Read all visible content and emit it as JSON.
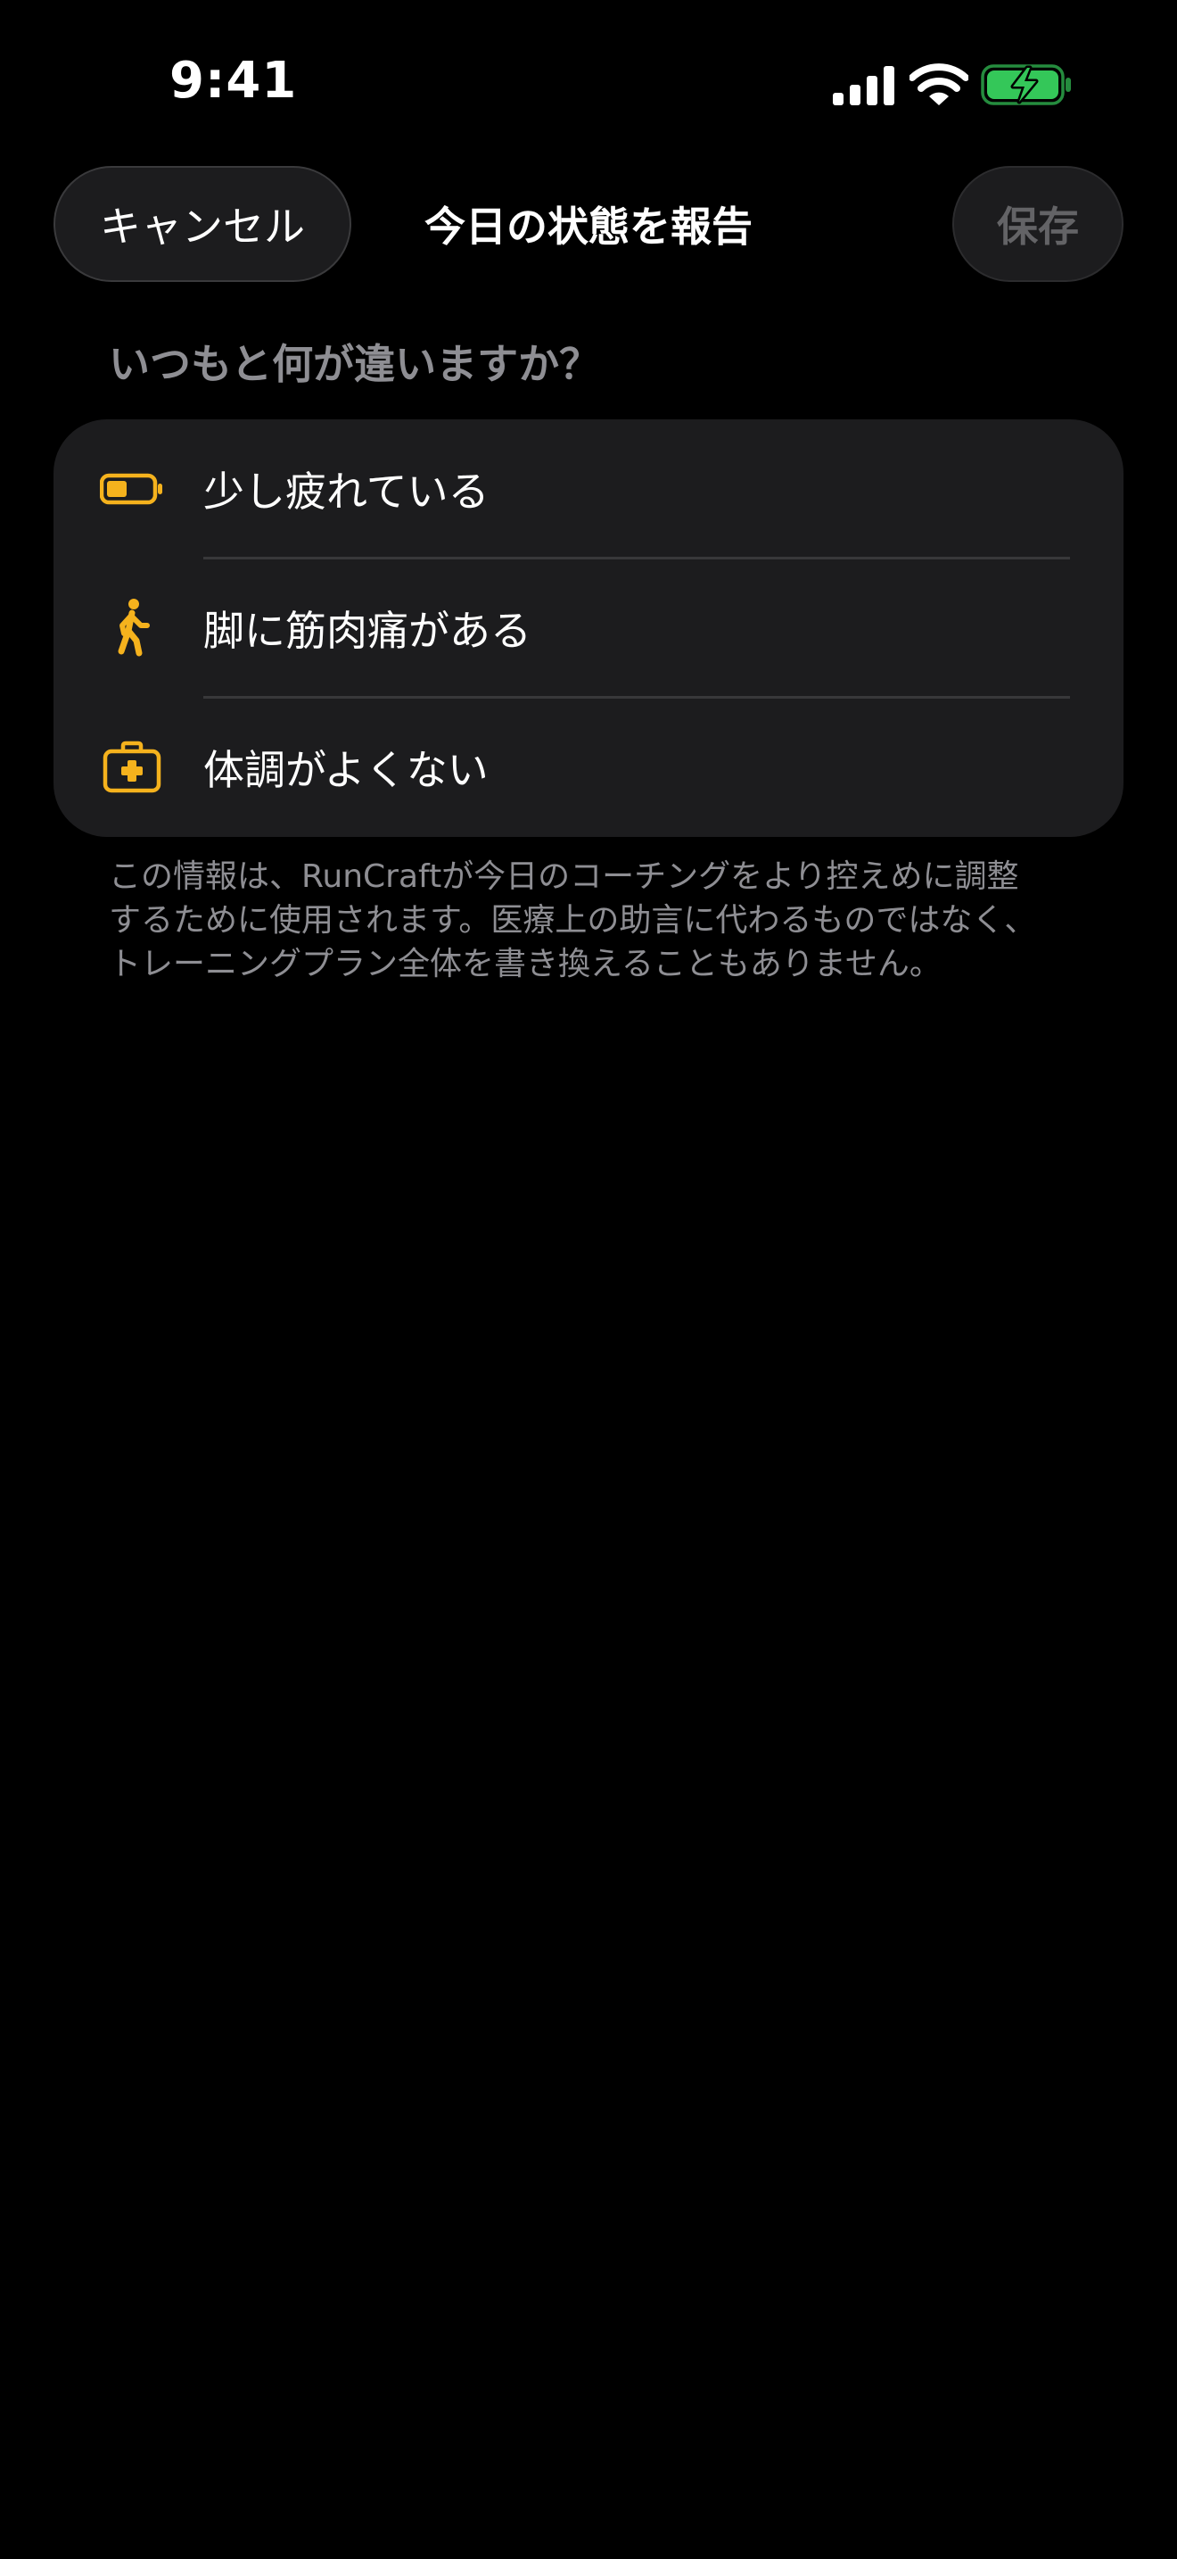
{
  "status_bar": {
    "time": "9:41",
    "icons": [
      "signal-icon",
      "wifi-icon",
      "battery-charging-icon"
    ],
    "battery_color": "#34c759"
  },
  "nav": {
    "cancel_label": "キャンセル",
    "title": "今日の状態を報告",
    "save_label": "保存"
  },
  "section": {
    "header": "いつもと何が違いますか？"
  },
  "options": [
    {
      "label": "少し疲れている",
      "icon": "battery-low-icon"
    },
    {
      "label": "脚に筋肉痛がある",
      "icon": "walking-figure-icon"
    },
    {
      "label": "体調がよくない",
      "icon": "medical-kit-icon"
    }
  ],
  "footer": {
    "lines": [
      "この情報は、RunCraftが今日のコーチングをより控えめに調整",
      "するために使用されます。医療上の助言に代わるものではなく、",
      "トレーニングプラン全体を書き換えることもありません。"
    ]
  },
  "colors": {
    "background": "#000000",
    "card": "#1c1c1e",
    "accent": "#f5b21d",
    "secondary_text": "#8e8e93",
    "disabled_text": "#636366"
  }
}
